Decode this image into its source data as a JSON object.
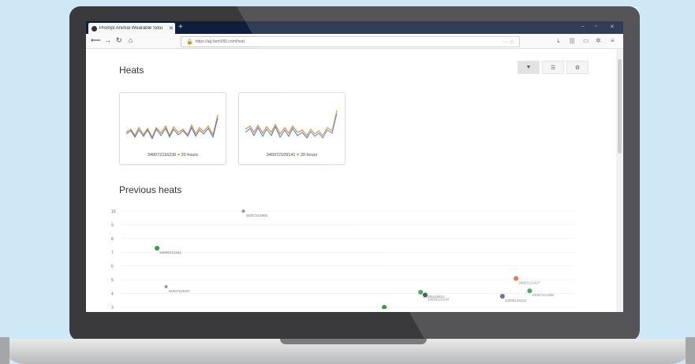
{
  "browser": {
    "tab_title": "Prompt Animal Wearable Solu",
    "tab_close": "✕",
    "new_tab": "+",
    "url": "https://ag.farm365.com/heat",
    "window_controls": [
      "–",
      "▫",
      "✕"
    ],
    "nav_icons": [
      "back-icon",
      "forward-icon",
      "reload-icon",
      "home-icon"
    ],
    "toolbar_icons": [
      "download-icon",
      "library-icon",
      "sidebar-icon",
      "extension-icon",
      "menu-icon"
    ]
  },
  "page": {
    "heats_title": "Heats",
    "view_buttons": [
      "heart-icon",
      "list-icon",
      "gear-icon"
    ],
    "cards": [
      {
        "id": "340072116236",
        "hours": "20 hours"
      },
      {
        "id": "340072109141",
        "hours": "20 hours"
      }
    ],
    "previous_heats_title": "Previous heats"
  },
  "colors": {
    "heart": "#e8852a",
    "activity_blue": "#3a7fd0",
    "activity_orange": "#e58b3a",
    "dot_green": "#2ea043",
    "dot_dark": "#2f4c3a",
    "dot_orange": "#e0642e",
    "dot_purple": "#5a5690"
  },
  "chart_data": {
    "type": "scatter",
    "y_ticks": [
      "10",
      "9",
      "8",
      "7",
      "6",
      "5",
      "4",
      "3"
    ],
    "ylim": [
      3,
      10
    ],
    "points": [
      {
        "label": "34007210965",
        "x": 0.27,
        "y": 10,
        "color": "gray"
      },
      {
        "label": "34008141261",
        "x": 0.08,
        "y": 7.3,
        "color": "green"
      },
      {
        "label": "34007110637",
        "x": 0.1,
        "y": 4.5,
        "color": "gray"
      },
      {
        "label": "34008148810",
        "x": 0.66,
        "y": 4.1,
        "color": "green"
      },
      {
        "label": "34008115240",
        "x": 0.67,
        "y": 3.9,
        "color": "dark"
      },
      {
        "label": "34008108123",
        "x": 0.58,
        "y": 3.0,
        "color": "green"
      },
      {
        "label": "34007121427",
        "x": 0.87,
        "y": 5.1,
        "color": "orange"
      },
      {
        "label": "34008108102",
        "x": 0.84,
        "y": 3.8,
        "color": "purple"
      },
      {
        "label": "34007121395",
        "x": 0.9,
        "y": 4.2,
        "color": "green"
      }
    ]
  }
}
